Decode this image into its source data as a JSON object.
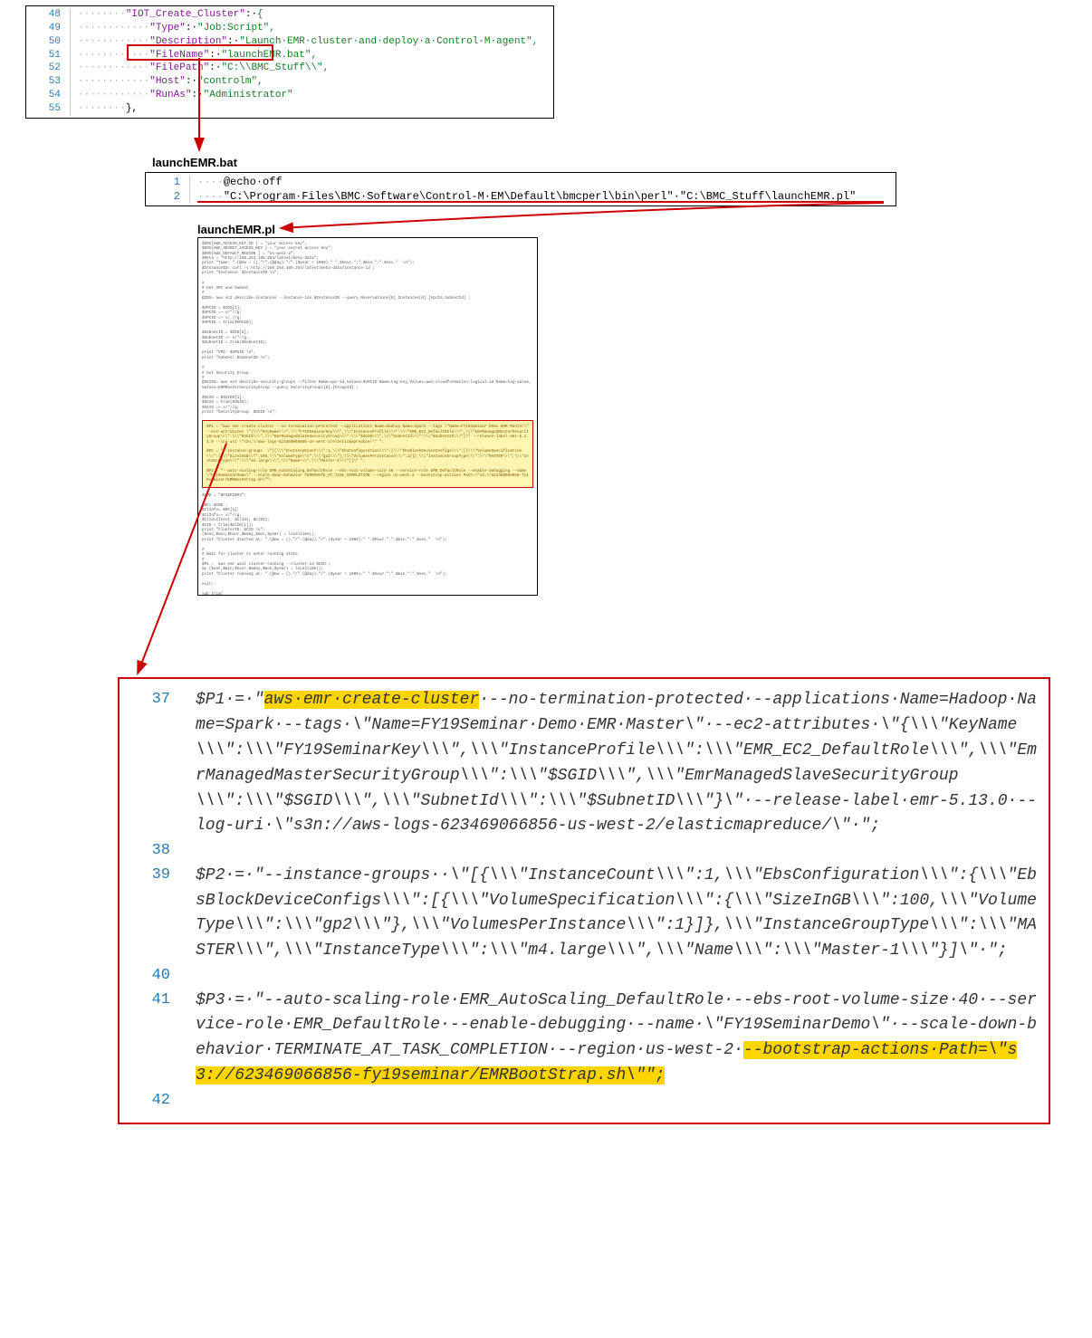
{
  "box1": {
    "lines": [
      {
        "n": "48",
        "indent": "········",
        "text": "\"IOT_Create_Cluster\":·{"
      },
      {
        "n": "49",
        "indent": "············",
        "text": "\"Type\":·\"Job:Script\","
      },
      {
        "n": "50",
        "indent": "············",
        "text": "\"Description\":·\"Launch·EMR·cluster·and·deploy·a·Control-M·agent\","
      },
      {
        "n": "51",
        "indent": "············",
        "text": "\"FileName\":·\"launchEMR.bat\","
      },
      {
        "n": "52",
        "indent": "············",
        "text": "\"FilePath\":·\"C:\\\\BMC_Stuff\\\\\","
      },
      {
        "n": "53",
        "indent": "············",
        "text": "\"Host\":·\"controlm\","
      },
      {
        "n": "54",
        "indent": "············",
        "text": "\"RunAs\":·\"Administrator\""
      },
      {
        "n": "55",
        "indent": "········",
        "text": "},"
      }
    ]
  },
  "labels": {
    "bat": "launchEMR.bat",
    "pl": "launchEMR.pl"
  },
  "box2": {
    "lines": [
      {
        "n": "1",
        "indent": "····",
        "text": "@echo·off"
      },
      {
        "n": "2",
        "indent": "····",
        "text": "\"C:\\Program·Files\\BMC·Software\\Control-M·EM\\Default\\bmcperl\\bin\\perl\"·\"C:\\BMC_Stuff\\launchEMR.pl\""
      }
    ]
  },
  "box3": {
    "top_blocks": [
      "$ENV{AWS_ACCESS_KEY_ID } = \"your access key\";\n$ENV{AWS_SECRET_ACCESS_KEY } = \"your secret access key\";\n$ENV{AWS_DEFAULT_REGION } = \"us-west-2\";\n$Meta = \"http://169.254.169.254/latest/meta-data\";\nprint \"Time: \".(@nw = ().\"/\".(@day).\"/\".($year + 1900).\" \".$hour.\":\".$min.\":\".$sec.\"  \\n\");\n$InstanceID=`curl -s http://169.254.169.254/latest/meta-data/instance-id`;\nprint \"Instance: $InstanceID \\n\";",
      "#\n# Get VPC and Subnet\n#\n@IDS=`aws ec2 describe-instances --instance-ids $InstanceID --query Reservations[0].Instances[0].[VpcId,SubnetId]`;",
      "$VPCID = $IDS[1];\n$VPCID =~ s/\"//g;\n$VPCID =~ s/,//g;\n$VPCID = trim($VPCID);",
      "$SubnetID = $IDS[2];\n$SubnetID =~ s/\"//g;\n$SubnetID = trim($SubnetID);",
      "print \"VPC: $VPCID \\n\";\nprint \"Subnet: $SubnetID \\n\";",
      "#\n# Get Security Group\n#\n@SGIDS=`aws ec2 describe-security-groups --filter Name=vpc-id,Values=$VPCID Name=tag-key,Values=aws:cloudformation:logical-id Name=tag-value,Values=EMRMasterSecurityGroup --query SecurityGroups[0].[GroupId]`;",
      "$SGID = $SGIDS[1];\n$SGID = trim($SGID);\n$SGID =~ s/\"//g;\nprint \"SecurityGroup: $SGID \\n\";"
    ],
    "highlight": "$P1 = \"aws emr create-cluster --no-termination-protected --applications Name=Hadoop Name=Spark --tags \\\"Name=FY19Seminar Demo EMR Master\\\" --ec2-attributes \\\"{\\\\\\\"KeyName\\\\\\\":\\\\\\\"FY19SeminarKey\\\\\\\",\\\\\\\"InstanceProfile\\\\\\\":\\\\\\\"EMR_EC2_DefaultRole\\\\\\\",\\\\\\\"EmrManagedMasterSecurityGroup\\\\\\\":\\\\\\\"$SGID\\\\\\\",\\\\\\\"EmrManagedSlaveSecurityGroup\\\\\\\":\\\\\\\"$SGID\\\\\\\",\\\\\\\"SubnetId\\\\\\\":\\\\\\\"$SubnetID\\\\\\\"}\\\" --release-label emr-5.13.0 --log-uri \\\"s3n://aws-logs-623469066856-us-west-2/elasticmapreduce/\\\" \";\n\n$P2 = \"--instance-groups  \\\"[{\\\\\\\"InstanceCount\\\\\\\":1,\\\\\\\"EbsConfiguration\\\\\\\":{\\\\\\\"EbsBlockDeviceConfigs\\\\\\\":[{\\\\\\\"VolumeSpecification\\\\\\\":{\\\\\\\"SizeInGB\\\\\\\":100,\\\\\\\"VolumeType\\\\\\\":\\\\\\\"gp2\\\\\\\"},\\\\\\\"VolumesPerInstance\\\\\\\":1}]},\\\\\\\"InstanceGroupType\\\\\\\":\\\\\\\"MASTER\\\\\\\",\\\\\\\"InstanceType\\\\\\\":\\\\\\\"m4.large\\\\\\\",\\\\\\\"Name\\\\\\\":\\\\\\\"Master-1\\\\\\\"}]\\\" \";\n\n$P3 = \"--auto-scaling-role EMR_AutoScaling_DefaultRole --ebs-root-volume-size 40 --service-role EMR_DefaultRole --enable-debugging --name \\\"FY19SeminarDemo\\\" --scale-down-behavior TERMINATE_AT_TASK_COMPLETION --region us-west-2 --bootstrap-actions Path=\\\"s3://623469066856-fy19seminar/EMRBootStrap.sh\\\"\";",
    "bottom_blocks": [
      "$CMD = \"$P1$P2$P3\";",
      "@RC=`$CMD`;\n$ClInfo= $RC[1];\n$ClInfo=~ s/\"//g;\n$ClId=Cltest, $ClId1, $ClID);\n$CID = trim($ClID[1]);\nprint \"ClusterID: $CID \\n\";\n($sec,$min,$hour,$mday,$mon,$year) = localtime();\nprint \"Cluster Started at: \".(@nw = ().\"/\".(@day).\"/\".($year + 1900).\" \".$hour.\":\".$min.\":\".$sec.\"  \\n\");",
      "#\n# Wait for cluster to enter running state\n#\n$P1 = `aws emr wait cluster-running --cluster-id $CID`;\nmy ($sec,$min,$hour,$mday,$mon,$year) = localtime();\nprint \"Cluster running at: \".(@nw = ().\"/\".(@day).\"/\".($year + 1900).\" \".$hour.\":\".$min.\":\".$sec.\"  \\n\");",
      "exit;",
      "sub trim{\n ...\n};"
    ]
  },
  "box4": {
    "lines": [
      {
        "n": "37",
        "hl_start": "$P1·=·\"",
        "hl": "aws·emr·create-cluster",
        "rest": "·--no-termination-protected·--applications·Name=Hadoop·Name=Spark·--tags·\\\"Name=FY19Seminar·Demo·EMR·Master\\\"·--ec2-attributes·\\\"{\\\\\\\"KeyName\\\\\\\":\\\\\\\"FY19SeminarKey\\\\\\\",\\\\\\\"InstanceProfile\\\\\\\":\\\\\\\"EMR_EC2_DefaultRole\\\\\\\",\\\\\\\"EmrManagedMasterSecurityGroup\\\\\\\":\\\\\\\"$SGID\\\\\\\",\\\\\\\"EmrManagedSlaveSecurityGroup\\\\\\\":\\\\\\\"$SGID\\\\\\\",\\\\\\\"SubnetId\\\\\\\":\\\\\\\"$SubnetID\\\\\\\"}\\\"·--release-label·emr-5.13.0·--log-uri·\\\"s3n://aws-logs-623469066856-us-west-2/elasticmapreduce/\\\"·\";"
      },
      {
        "n": "38",
        "plain": ""
      },
      {
        "n": "39",
        "plain": "$P2·=·\"--instance-groups··\\\"[{\\\\\\\"InstanceCount\\\\\\\":1,\\\\\\\"EbsConfiguration\\\\\\\":{\\\\\\\"EbsBlockDeviceConfigs\\\\\\\":[{\\\\\\\"VolumeSpecification\\\\\\\":{\\\\\\\"SizeInGB\\\\\\\":100,\\\\\\\"VolumeType\\\\\\\":\\\\\\\"gp2\\\\\\\"},\\\\\\\"VolumesPerInstance\\\\\\\":1}]},\\\\\\\"InstanceGroupType\\\\\\\":\\\\\\\"MASTER\\\\\\\",\\\\\\\"InstanceType\\\\\\\":\\\\\\\"m4.large\\\\\\\",\\\\\\\"Name\\\\\\\":\\\\\\\"Master-1\\\\\\\"}]\\\"·\";"
      },
      {
        "n": "40",
        "plain": ""
      },
      {
        "n": "41",
        "tail_hl_pre": "$P3·=·\"--auto-scaling-role·EMR_AutoScaling_DefaultRole·--ebs-root-volume-size·40·--service-role·EMR_DefaultRole·--enable-debugging·--name·\\\"FY19SeminarDemo\\\"·--scale-down-behavior·TERMINATE_AT_TASK_COMPLETION·--region·us-west-2·",
        "tail_hl": "--bootstrap-actions·Path=\\\"s3://623469066856-fy19seminar/EMRBootStrap.sh\\\"\";"
      },
      {
        "n": "42",
        "plain": ""
      }
    ]
  }
}
